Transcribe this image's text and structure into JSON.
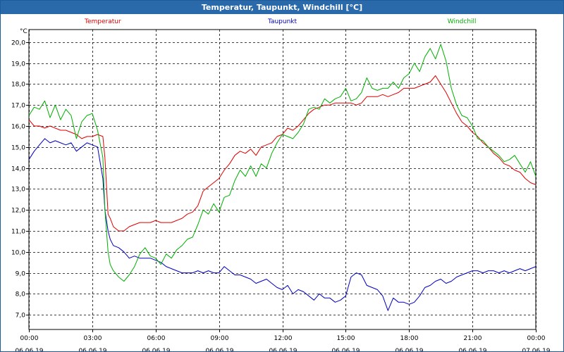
{
  "window": {
    "title": "Temperatur, Taupunkt, Windchill [°C]"
  },
  "chart_data": {
    "type": "line",
    "title": "Temperatur, Taupunkt, Windchill [°C]",
    "ylabel": "°C",
    "ylim": [
      6.3,
      20.6
    ],
    "yticks": [
      7.0,
      8.0,
      9.0,
      10.0,
      11.0,
      12.0,
      13.0,
      14.0,
      15.0,
      16.0,
      17.0,
      18.0,
      19.0,
      20.0
    ],
    "xlim_hours": [
      0,
      24
    ],
    "xticks": [
      {
        "hour": 0,
        "time": "00:00",
        "date": "06.06.19"
      },
      {
        "hour": 3,
        "time": "03:00",
        "date": "06.06.19"
      },
      {
        "hour": 6,
        "time": "06:00",
        "date": "06.06.19"
      },
      {
        "hour": 9,
        "time": "09:00",
        "date": "06.06.19"
      },
      {
        "hour": 12,
        "time": "12:00",
        "date": "06.06.19"
      },
      {
        "hour": 15,
        "time": "15:00",
        "date": "06.06.19"
      },
      {
        "hour": 18,
        "time": "18:00",
        "date": "06.06.19"
      },
      {
        "hour": 21,
        "time": "21:00",
        "date": "06.06.19"
      },
      {
        "hour": 24,
        "time": "00:00",
        "date": "07.06.19"
      }
    ],
    "grid": true,
    "legend_position": "top",
    "series": [
      {
        "name": "Temperatur",
        "color": "#e00000",
        "legend_x_hour": 3.5,
        "x": [
          0,
          0.25,
          0.5,
          0.75,
          1,
          1.25,
          1.5,
          1.75,
          2,
          2.25,
          2.5,
          2.75,
          3,
          3.25,
          3.5,
          3.6,
          3.75,
          3.85,
          4,
          4.25,
          4.5,
          4.75,
          5,
          5.25,
          5.5,
          5.75,
          6,
          6.25,
          6.5,
          6.75,
          7,
          7.25,
          7.5,
          7.75,
          8,
          8.25,
          8.5,
          8.75,
          9,
          9.25,
          9.5,
          9.75,
          10,
          10.25,
          10.5,
          10.75,
          11,
          11.25,
          11.5,
          11.75,
          12,
          12.25,
          12.5,
          12.75,
          13,
          13.25,
          13.5,
          13.75,
          14,
          14.25,
          14.5,
          14.75,
          15,
          15.25,
          15.5,
          15.75,
          16,
          16.25,
          16.5,
          16.75,
          17,
          17.25,
          17.5,
          17.75,
          18,
          18.25,
          18.5,
          18.75,
          19,
          19.25,
          19.5,
          19.75,
          20,
          20.25,
          20.5,
          20.75,
          21,
          21.25,
          21.5,
          21.75,
          22,
          22.25,
          22.5,
          22.75,
          23,
          23.25,
          23.5,
          23.75,
          24
        ],
        "values": [
          16.3,
          16.0,
          16.0,
          15.9,
          16.0,
          15.9,
          15.8,
          15.8,
          15.7,
          15.6,
          15.4,
          15.5,
          15.5,
          15.6,
          15.5,
          14.5,
          11.8,
          11.6,
          11.2,
          11.0,
          11.0,
          11.2,
          11.3,
          11.4,
          11.4,
          11.4,
          11.5,
          11.4,
          11.4,
          11.4,
          11.5,
          11.6,
          11.8,
          11.9,
          12.2,
          12.9,
          13.1,
          13.3,
          13.5,
          13.9,
          14.2,
          14.6,
          14.8,
          14.7,
          14.9,
          14.6,
          15.0,
          15.1,
          15.2,
          15.5,
          15.6,
          15.9,
          15.8,
          16.0,
          16.3,
          16.6,
          16.8,
          16.9,
          17.0,
          17.0,
          17.1,
          17.1,
          17.1,
          17.1,
          17.0,
          17.1,
          17.4,
          17.4,
          17.4,
          17.5,
          17.4,
          17.5,
          17.6,
          17.8,
          17.8,
          17.8,
          17.9,
          18.0,
          18.1,
          18.4,
          18.0,
          17.6,
          17.1,
          16.6,
          16.2,
          16.0,
          15.7,
          15.5,
          15.2,
          15.0,
          14.7,
          14.5,
          14.2,
          14.1,
          13.9,
          13.8,
          13.5,
          13.3,
          13.2
        ],
        "note": ""
      },
      {
        "name": "Taupunkt",
        "color": "#0000c0",
        "legend_x_hour": 12,
        "x": [
          0,
          0.25,
          0.5,
          0.75,
          1,
          1.25,
          1.5,
          1.75,
          2,
          2.25,
          2.5,
          2.75,
          3,
          3.25,
          3.5,
          3.6,
          3.75,
          3.85,
          4,
          4.25,
          4.5,
          4.75,
          5,
          5.25,
          5.5,
          5.75,
          6,
          6.25,
          6.5,
          6.75,
          7,
          7.25,
          7.5,
          7.75,
          8,
          8.25,
          8.5,
          8.75,
          9,
          9.25,
          9.5,
          9.75,
          10,
          10.25,
          10.5,
          10.75,
          11,
          11.25,
          11.5,
          11.75,
          12,
          12.25,
          12.5,
          12.75,
          13,
          13.25,
          13.5,
          13.75,
          14,
          14.25,
          14.5,
          14.75,
          15,
          15.25,
          15.5,
          15.75,
          16,
          16.25,
          16.5,
          16.75,
          17,
          17.25,
          17.5,
          17.75,
          18,
          18.25,
          18.5,
          18.75,
          19,
          19.25,
          19.5,
          19.75,
          20,
          20.25,
          20.5,
          20.75,
          21,
          21.25,
          21.5,
          21.75,
          22,
          22.25,
          22.5,
          22.75,
          23,
          23.25,
          23.5,
          23.75,
          24
        ],
        "values": [
          14.4,
          14.8,
          15.1,
          15.4,
          15.2,
          15.3,
          15.2,
          15.1,
          15.2,
          14.8,
          15.0,
          15.2,
          15.1,
          15.0,
          13.5,
          12.0,
          11.0,
          10.6,
          10.3,
          10.2,
          10.0,
          9.7,
          9.8,
          9.7,
          9.7,
          9.7,
          9.6,
          9.5,
          9.3,
          9.2,
          9.1,
          9.0,
          9.0,
          9.0,
          9.1,
          9.0,
          9.1,
          9.0,
          9.0,
          9.3,
          9.1,
          8.9,
          8.9,
          8.8,
          8.7,
          8.5,
          8.6,
          8.7,
          8.5,
          8.3,
          8.2,
          8.4,
          8.0,
          8.2,
          8.1,
          7.9,
          7.7,
          8.0,
          7.8,
          7.8,
          7.6,
          7.7,
          7.9,
          8.8,
          9.0,
          8.9,
          8.4,
          8.3,
          8.2,
          7.9,
          7.2,
          7.8,
          7.6,
          7.6,
          7.5,
          7.6,
          7.9,
          8.3,
          8.4,
          8.6,
          8.7,
          8.5,
          8.6,
          8.8,
          8.9,
          9.0,
          9.1,
          9.1,
          9.0,
          9.1,
          9.1,
          9.0,
          9.1,
          9.0,
          9.1,
          9.2,
          9.1,
          9.2,
          9.3
        ],
        "note": ""
      },
      {
        "name": "Windchill",
        "color": "#00b000",
        "legend_x_hour": 20.5,
        "x": [
          0,
          0.25,
          0.5,
          0.75,
          1,
          1.25,
          1.5,
          1.75,
          2,
          2.25,
          2.5,
          2.75,
          3,
          3.25,
          3.5,
          3.6,
          3.75,
          3.85,
          4,
          4.25,
          4.5,
          4.75,
          5,
          5.25,
          5.5,
          5.75,
          6,
          6.25,
          6.5,
          6.75,
          7,
          7.25,
          7.5,
          7.75,
          8,
          8.25,
          8.5,
          8.75,
          9,
          9.25,
          9.5,
          9.75,
          10,
          10.25,
          10.5,
          10.75,
          11,
          11.25,
          11.5,
          11.75,
          12,
          12.25,
          12.5,
          12.75,
          13,
          13.25,
          13.5,
          13.75,
          14,
          14.25,
          14.5,
          14.75,
          15,
          15.25,
          15.5,
          15.75,
          16,
          16.25,
          16.5,
          16.75,
          17,
          17.25,
          17.5,
          17.75,
          18,
          18.25,
          18.5,
          18.75,
          19,
          19.25,
          19.5,
          19.75,
          20,
          20.25,
          20.5,
          20.75,
          21,
          21.25,
          21.5,
          21.75,
          22,
          22.25,
          22.5,
          22.75,
          23,
          23.25,
          23.5,
          23.75,
          24
        ],
        "values": [
          16.5,
          16.9,
          16.8,
          17.2,
          16.4,
          17.0,
          16.3,
          16.8,
          16.5,
          15.4,
          16.2,
          16.5,
          16.6,
          15.8,
          14.5,
          12.0,
          10.0,
          9.4,
          9.1,
          8.8,
          8.6,
          8.9,
          9.3,
          9.9,
          10.2,
          9.8,
          9.7,
          9.4,
          9.9,
          9.7,
          10.1,
          10.3,
          10.6,
          10.7,
          11.3,
          12.0,
          11.8,
          12.3,
          11.9,
          12.6,
          12.7,
          13.4,
          13.9,
          13.6,
          14.1,
          13.6,
          14.2,
          14.0,
          14.7,
          15.2,
          15.6,
          15.5,
          15.4,
          15.7,
          16.1,
          16.8,
          16.9,
          16.8,
          17.3,
          17.1,
          17.3,
          17.4,
          17.8,
          17.2,
          17.3,
          17.6,
          18.3,
          17.8,
          17.7,
          17.8,
          17.8,
          18.1,
          17.8,
          18.3,
          18.5,
          19.0,
          18.6,
          19.3,
          19.7,
          19.2,
          19.9,
          19.1,
          17.8,
          17.0,
          16.5,
          16.4,
          16.0,
          15.4,
          15.3,
          15.0,
          14.8,
          14.6,
          14.3,
          14.4,
          14.6,
          14.2,
          13.8,
          14.3,
          13.6
        ],
        "note": ""
      }
    ]
  }
}
